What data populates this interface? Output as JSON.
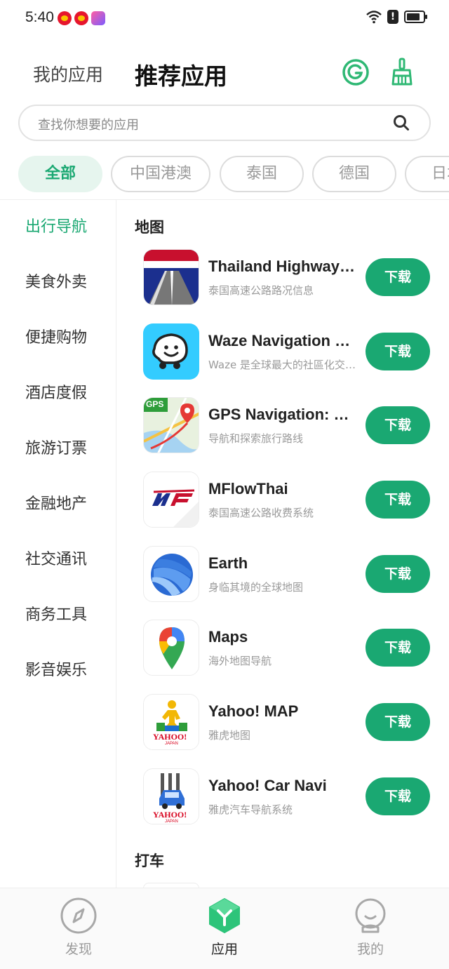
{
  "status_bar": {
    "time": "5:40"
  },
  "header": {
    "tab_my_apps": "我的应用",
    "tab_recommended": "推荐应用"
  },
  "search": {
    "placeholder": "查找你想要的应用"
  },
  "chips": [
    {
      "label": "全部",
      "active": true
    },
    {
      "label": "中国港澳",
      "active": false
    },
    {
      "label": "泰国",
      "active": false
    },
    {
      "label": "德国",
      "active": false
    },
    {
      "label": "日本",
      "active": false
    }
  ],
  "sidebar": {
    "items": [
      {
        "label": "出行导航",
        "active": true
      },
      {
        "label": "美食外卖"
      },
      {
        "label": "便捷购物"
      },
      {
        "label": "酒店度假"
      },
      {
        "label": "旅游订票"
      },
      {
        "label": "金融地产"
      },
      {
        "label": "社交通讯"
      },
      {
        "label": "商务工具"
      },
      {
        "label": "影音娱乐"
      }
    ]
  },
  "sections": [
    {
      "title": "地图",
      "apps": [
        {
          "name": "Thailand Highway Traffic",
          "desc": "泰国高速公路路况信息",
          "button": "下载",
          "icon": "thailand-highway-icon"
        },
        {
          "name": "Waze Navigation & Live Traffic",
          "desc": "Waze 是全球最大的社區化交通導航應用",
          "button": "下载",
          "icon": "waze-icon"
        },
        {
          "name": "GPS Navigation: Maps & Traffic",
          "desc": "导航和探索旅行路线",
          "button": "下载",
          "icon": "gps-navigation-icon"
        },
        {
          "name": "MFlowThai",
          "desc": "泰国高速公路收费系统",
          "button": "下载",
          "icon": "mflow-icon"
        },
        {
          "name": "Earth",
          "desc": "身临其境的全球地图",
          "button": "下载",
          "icon": "google-earth-icon"
        },
        {
          "name": "Maps",
          "desc": "海外地图导航",
          "button": "下载",
          "icon": "google-maps-icon"
        },
        {
          "name": "Yahoo! MAP",
          "desc": "雅虎地图",
          "button": "下载",
          "icon": "yahoo-map-icon"
        },
        {
          "name": "Yahoo! Car Navi",
          "desc": "雅虎汽车导航系统",
          "button": "下载",
          "icon": "yahoo-car-navi-icon"
        }
      ]
    },
    {
      "title": "打车",
      "apps": []
    }
  ],
  "icon_texts": {
    "gps_badge": "GPS",
    "yahoo_logo": "YAHOO!",
    "yahoo_japan": "JAPAN"
  },
  "bottom_nav": [
    {
      "label": "发现",
      "icon": "compass-icon",
      "active": false
    },
    {
      "label": "应用",
      "icon": "apps-hexagon-icon",
      "active": true
    },
    {
      "label": "我的",
      "icon": "profile-icon",
      "active": false
    }
  ],
  "colors": {
    "accent": "#1aa872",
    "accent_bg": "#e6f5ee",
    "text_muted": "#9a9a9a"
  }
}
